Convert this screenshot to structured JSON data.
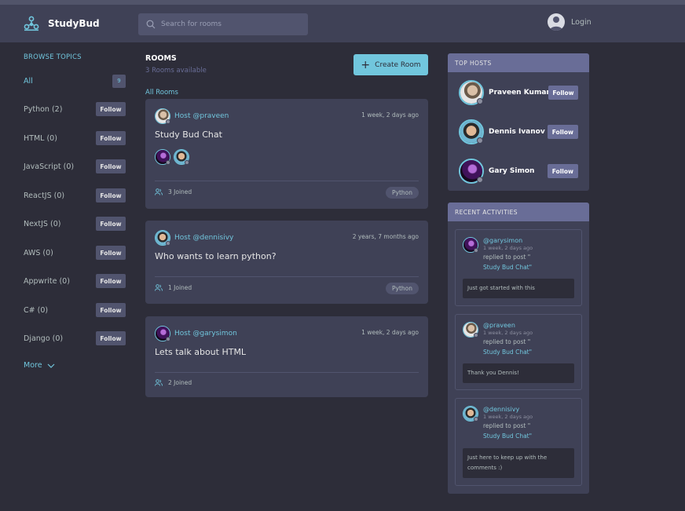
{
  "header": {
    "app_name": "StudyBud",
    "search_placeholder": "Search for rooms",
    "login_label": "Login"
  },
  "sidebar": {
    "title": "BROWSE TOPICS",
    "all_label": "All",
    "all_count": "9",
    "follow_label": "Follow",
    "topics": [
      "Python (2)",
      "HTML (0)",
      "JavaScript (0)",
      "ReactJS (0)",
      "NextJS (0)",
      "AWS (0)",
      "Appwrite (0)",
      "C# (0)",
      "Django (0)"
    ],
    "more_label": "More"
  },
  "rooms": {
    "title": "ROOMS",
    "subtitle": "3 Rooms available",
    "create_label": "Create Room",
    "all_rooms_label": "All Rooms",
    "items": [
      {
        "host": "Host @praveen",
        "time": "1 week, 2 days ago",
        "title": "Study Bud Chat",
        "joined": "3 Joined",
        "topic": "Python"
      },
      {
        "host": "Host @dennisivy",
        "time": "2 years, 7 months ago",
        "title": "Who wants to learn python?",
        "joined": "1 Joined",
        "topic": "Python"
      },
      {
        "host": "Host @garysimon",
        "time": "1 week, 2 days ago",
        "title": "Lets talk about HTML",
        "joined": "2 Joined",
        "topic": ""
      }
    ]
  },
  "top_hosts": {
    "title": "TOP HOSTS",
    "follow_label": "Follow",
    "hosts": [
      "Praveen Kumar",
      "Dennis Ivanov",
      "Gary Simon"
    ]
  },
  "activities": {
    "title": "RECENT ACTIVITIES",
    "items": [
      {
        "user": "@garysimon",
        "time": "1 week, 2 days ago",
        "action": "replied to post \"",
        "room": "Study Bud Chat\"",
        "message": "Just got started with this"
      },
      {
        "user": "@praveen",
        "time": "1 week, 2 days ago",
        "action": "replied to post \"",
        "room": "Study Bud Chat\"",
        "message": "Thank you Dennis!"
      },
      {
        "user": "@dennisivy",
        "time": "1 week, 2 days ago",
        "action": "replied to post \"",
        "room": "Study Bud Chat\"",
        "message": "Just here to keep up with the comments :)"
      }
    ]
  },
  "colors": {
    "background": "#2d2d39",
    "panel": "#3f4156",
    "accent": "#71c6dd",
    "header_accent": "#696d97"
  }
}
